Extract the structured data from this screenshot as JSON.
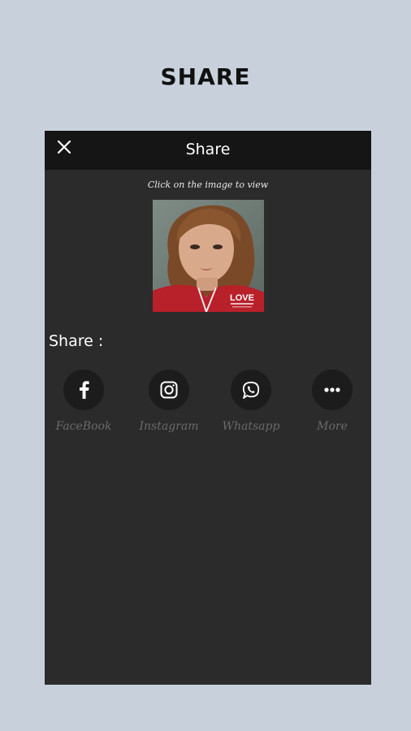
{
  "header": {
    "title": "SHARE"
  },
  "dialog": {
    "title": "Share",
    "hint": "Click on the image to view",
    "share_label": "Share :",
    "preview_overlay": "LOVE"
  },
  "share_options": [
    {
      "label": "FaceBook",
      "icon": "facebook-icon"
    },
    {
      "label": "Instagram",
      "icon": "instagram-icon"
    },
    {
      "label": "Whatsapp",
      "icon": "whatsapp-icon"
    },
    {
      "label": "More",
      "icon": "more-icon"
    }
  ],
  "colors": {
    "page_background": "#c8d1db",
    "dialog_background": "#2b2b2b",
    "topbar_background": "#151515",
    "icon_circle": "#1c1c1c",
    "option_label": "#6a6a6a"
  }
}
